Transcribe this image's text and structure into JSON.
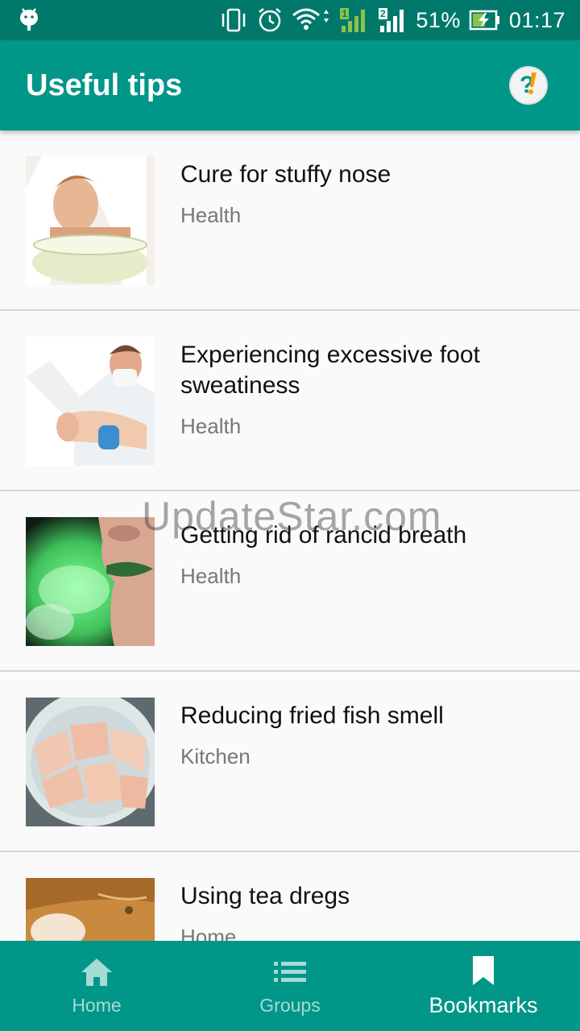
{
  "status_bar": {
    "battery": "51%",
    "time": "01:17",
    "sim1": "1",
    "sim2": "2"
  },
  "app_bar": {
    "title": "Useful tips",
    "help_icon": "help-question-icon"
  },
  "tips": [
    {
      "title": "Cure for stuffy nose",
      "category": "Health"
    },
    {
      "title": "Experiencing excessive foot sweatiness",
      "category": "Health"
    },
    {
      "title": "Getting rid of rancid breath",
      "category": "Health"
    },
    {
      "title": "Reducing fried fish smell",
      "category": "Kitchen"
    },
    {
      "title": "Using tea dregs",
      "category": "Home"
    }
  ],
  "watermark": "UpdateStar.com",
  "bottom_nav": {
    "home": "Home",
    "groups": "Groups",
    "bookmarks": "Bookmarks",
    "active": "bookmarks"
  },
  "colors": {
    "primary": "#009688",
    "primary_dark": "#00796b"
  }
}
